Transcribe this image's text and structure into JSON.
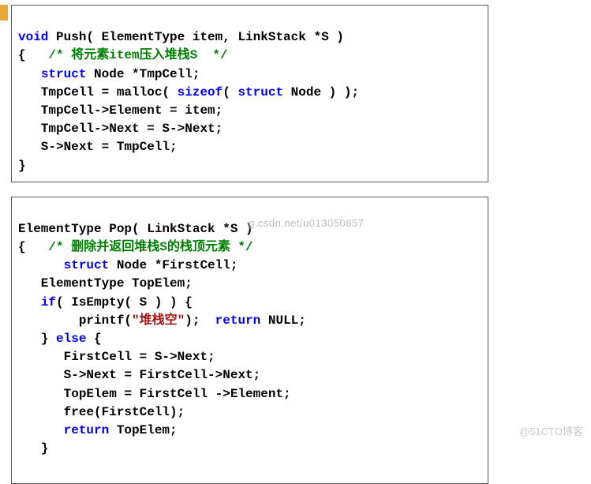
{
  "block1": {
    "l1_seg1": "void",
    "l1_seg2": " Push( ElementType item, LinkStack *S )",
    "l2_seg1": "{   ",
    "l2_comment": "/* 将元素item压入堆栈S  */",
    "l3_seg1": "   ",
    "l3_kw": "struct",
    "l3_seg2": " Node *TmpCell;",
    "l4_seg1": "   TmpCell = malloc( ",
    "l4_kw": "sizeof",
    "l4_seg2": "( ",
    "l4_kw2": "struct",
    "l4_seg3": " Node ) );",
    "l5": "   TmpCell->Element = item;",
    "l6": "   TmpCell->Next = S->Next;",
    "l7": "   S->Next = TmpCell;",
    "l8": "}"
  },
  "block2": {
    "l1": "ElementType Pop( LinkStack *S )",
    "l2_seg1": "{   ",
    "l2_comment": "/* 删除并返回堆栈S的栈顶元素 */",
    "l3_seg1": "      ",
    "l3_kw": "struct",
    "l3_seg2": " Node *FirstCell;",
    "l4": "   ElementType TopElem;",
    "l5_seg1": "   ",
    "l5_kw": "if",
    "l5_seg2": "( IsEmpty( S ) ) {",
    "l6_seg1": "        printf(",
    "l6_str": "\"堆栈空\"",
    "l6_seg2": ");  ",
    "l6_kw": "return",
    "l6_seg3": " NULL;",
    "l7_seg1": "   } ",
    "l7_kw": "else",
    "l7_seg2": " {",
    "l8": "      FirstCell = S->Next;",
    "l9": "      S->Next = FirstCell->Next;",
    "l10": "      TopElem = FirstCell ->Element;",
    "l11": "      free(FirstCell);",
    "l12_seg1": "      ",
    "l12_kw": "return",
    "l12_seg2": " TopElem;",
    "l13": "   }"
  },
  "watermarks": {
    "csdn": "g.csdn.net/u013050857",
    "cto": "@51CTO博客"
  }
}
